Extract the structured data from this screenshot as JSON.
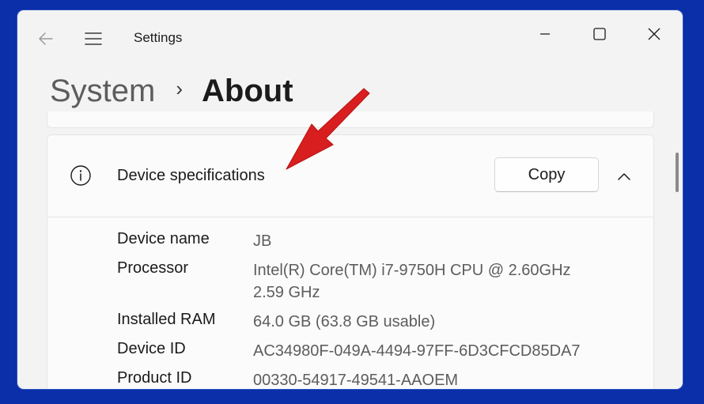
{
  "window": {
    "title": "Settings",
    "icons": {
      "back": "back-arrow-icon",
      "menu": "hamburger-menu-icon",
      "minimize": "minimize-icon",
      "maximize": "maximize-icon",
      "close": "close-icon"
    }
  },
  "breadcrumb": {
    "parent": "System",
    "separator": "›",
    "current": "About"
  },
  "device_specs": {
    "title": "Device specifications",
    "copy_label": "Copy",
    "expanded": true,
    "icons": {
      "info": "info-circle-icon",
      "collapse": "chevron-up-icon"
    },
    "rows": [
      {
        "label": "Device name",
        "value": "JB"
      },
      {
        "label": "Processor",
        "value": "Intel(R) Core(TM) i7-9750H CPU @ 2.60GHz",
        "value2": "2.59 GHz"
      },
      {
        "label": "Installed RAM",
        "value": "64.0 GB (63.8 GB usable)"
      },
      {
        "label": "Device ID",
        "value": "AC34980F-049A-4494-97FF-6D3CFCD85DA7"
      },
      {
        "label": "Product ID",
        "value": "00330-54917-49541-AAOEM"
      }
    ]
  },
  "annotation": {
    "type": "arrow",
    "color": "#d81e1e"
  },
  "colors": {
    "desktop": "#0a2fa8",
    "window_bg": "#f3f3f3",
    "card_bg": "#fbfbfb",
    "text_primary": "#1b1b1b",
    "text_secondary": "#5d5d5d"
  }
}
